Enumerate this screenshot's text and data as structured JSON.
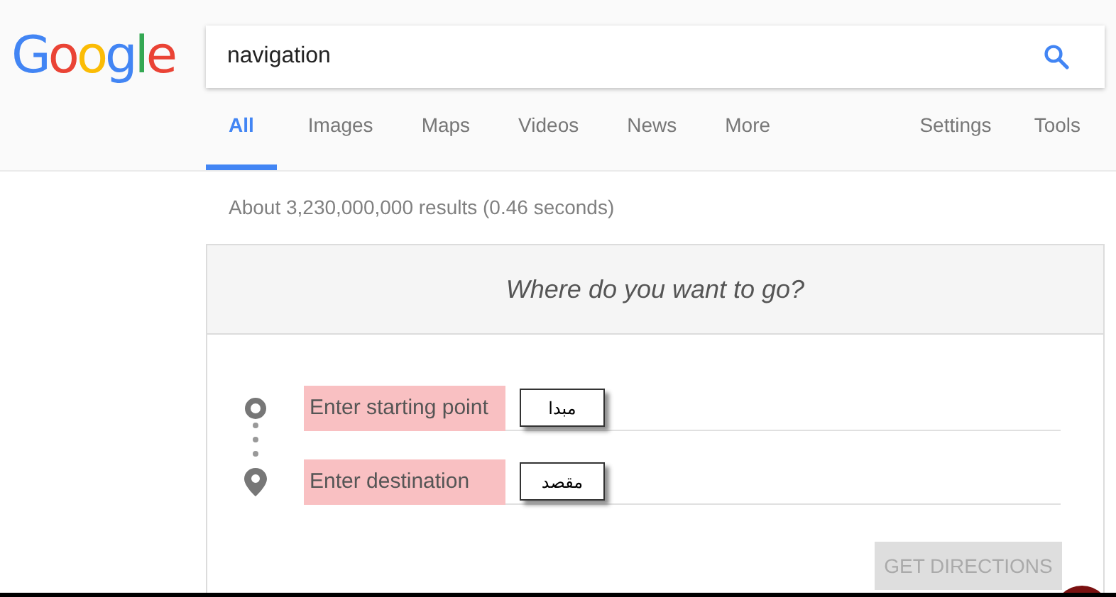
{
  "logo": "Google",
  "search": {
    "value": "navigation"
  },
  "tabs": [
    {
      "label": "All",
      "selected": true
    },
    {
      "label": "Images",
      "selected": false
    },
    {
      "label": "Maps",
      "selected": false
    },
    {
      "label": "Videos",
      "selected": false
    },
    {
      "label": "News",
      "selected": false
    },
    {
      "label": "More",
      "selected": false
    }
  ],
  "tools": [
    "Settings",
    "Tools"
  ],
  "result_stats": "About 3,230,000,000 results (0.46 seconds)",
  "directions": {
    "title": "Where do you want to go?",
    "fields": [
      {
        "kind": "start",
        "placeholder": "Enter starting point",
        "annotation": "مبدا"
      },
      {
        "kind": "destination",
        "placeholder": "Enter destination",
        "annotation": "مقصد"
      }
    ],
    "button": {
      "label": "GET DIRECTIONS",
      "disabled": true
    }
  }
}
